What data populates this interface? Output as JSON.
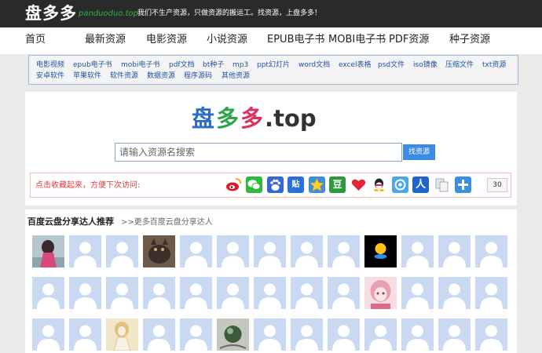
{
  "header": {
    "logo": "盘多多",
    "domain": "panduoduo.top",
    "slogan": "我们不生产资源，只做资源的搬运工。找资源，上盘多多！"
  },
  "nav": [
    "首页",
    "最新资源",
    "电影资源",
    "小说资源",
    "EPUB电子书",
    "MOBI电子书",
    "PDF资源",
    "种子资源"
  ],
  "tags": {
    "row1": [
      "电影视频",
      "epub电子书",
      "mobi电子书",
      "pdf文档",
      "bt种子",
      "mp3",
      "ppt幻灯片",
      "word文档",
      "excel表格",
      "psd文件",
      "iso镜像",
      "压缩文件",
      "txt资源"
    ],
    "row2": [
      "安卓软件",
      "苹果软件",
      "软件资源",
      "数据资源",
      "程序源码",
      "其他资源"
    ]
  },
  "search": {
    "logo_chars": [
      "盘",
      "多",
      "多"
    ],
    "logo_suffix": ".top",
    "placeholder": "请输入资源名搜索",
    "button": "找资源"
  },
  "share": {
    "label": "点击收藏起来，方便下次访问:",
    "icons": [
      "weibo-icon",
      "wechat-icon",
      "baidu-icon",
      "tieba-icon",
      "favorite-star-icon",
      "douban-icon",
      "heart-icon",
      "qq-icon",
      "qzone-icon",
      "renren-icon",
      "copy-icon",
      "plus-icon"
    ],
    "count": "30"
  },
  "users": {
    "title": "百度云盘分享达人推荐",
    "more": ">>更多百度云盘分享达人"
  },
  "colors": {
    "topbar": "#2a2a2a",
    "domain_green": "#2fb14b",
    "link_blue": "#1f50a6",
    "accent_blue": "#3b8be2",
    "share_red": "#e03c3c"
  }
}
